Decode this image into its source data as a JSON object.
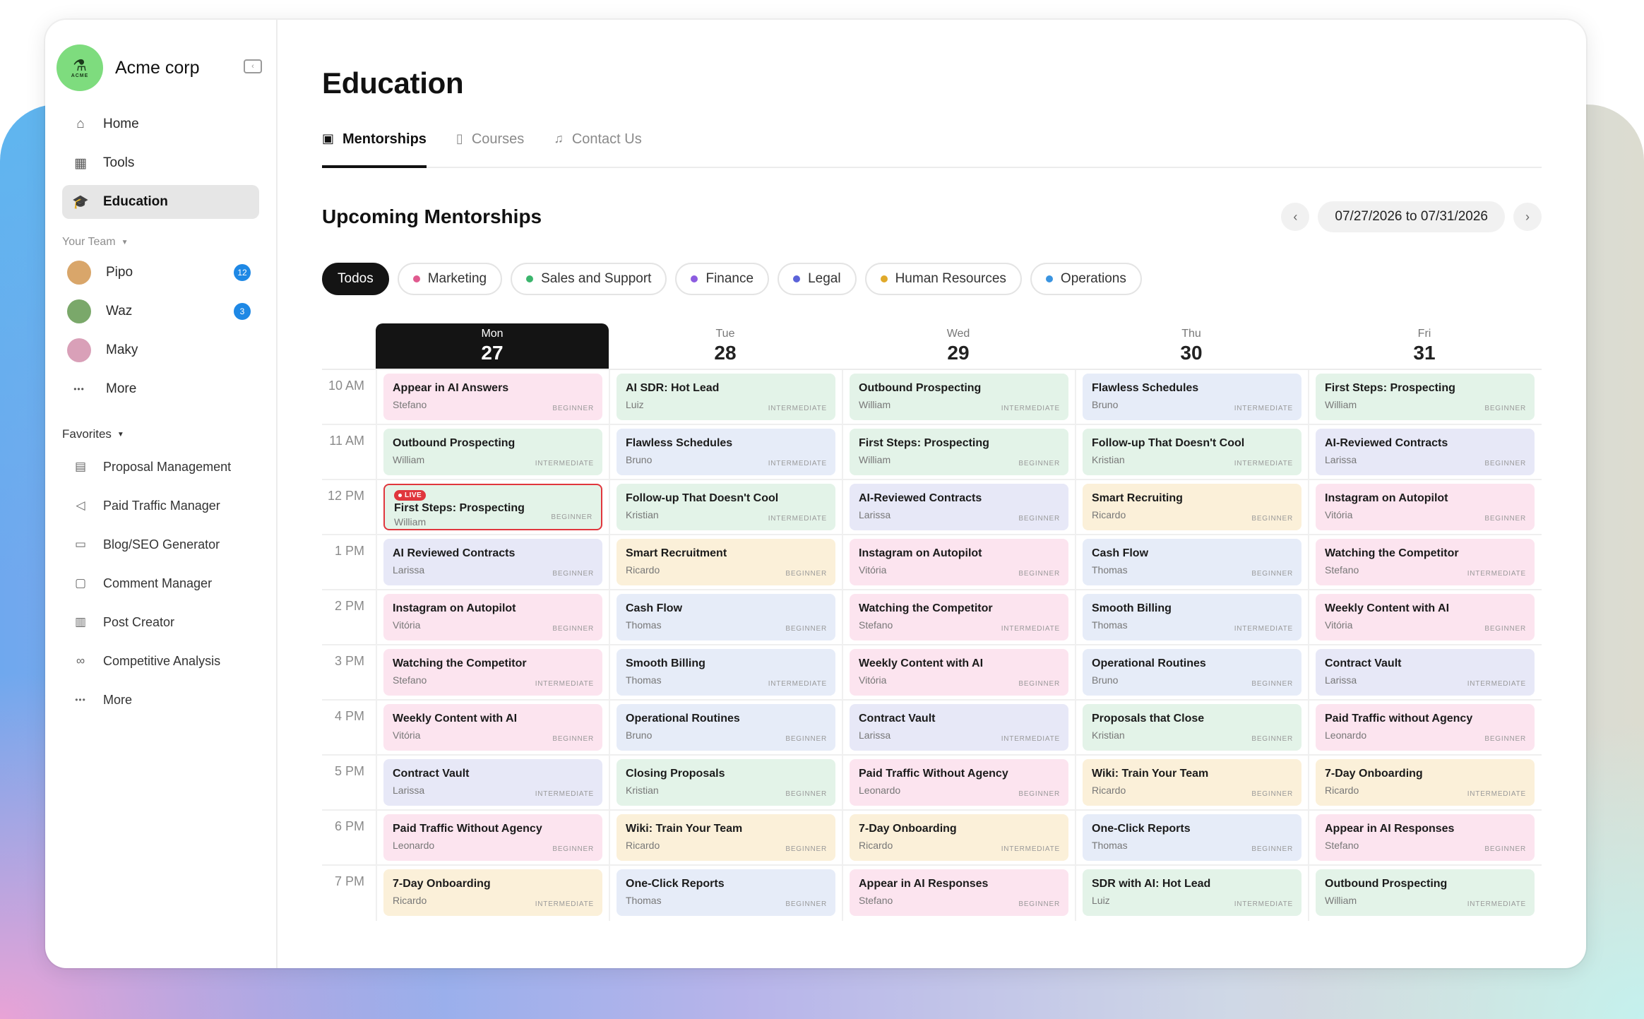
{
  "brand": {
    "name": "Acme corp",
    "logo_text": "ACME"
  },
  "nav": [
    {
      "label": "Home",
      "icon": "home-icon",
      "glyph": "⌂"
    },
    {
      "label": "Tools",
      "icon": "grid-icon",
      "glyph": "▦"
    },
    {
      "label": "Education",
      "icon": "graduation-cap-icon",
      "glyph": "🎓",
      "active": true
    }
  ],
  "team": {
    "label": "Your Team",
    "members": [
      {
        "name": "Pipo",
        "badge": "12",
        "color": "#d9a66a"
      },
      {
        "name": "Waz",
        "badge": "3",
        "color": "#7aa86a"
      },
      {
        "name": "Maky",
        "badge": "",
        "color": "#d9a0b8"
      }
    ],
    "more": "More"
  },
  "favorites": {
    "label": "Favorites",
    "items": [
      {
        "label": "Proposal Management",
        "icon": "document-icon",
        "glyph": "▤"
      },
      {
        "label": "Paid Traffic Manager",
        "icon": "megaphone-icon",
        "glyph": "◁"
      },
      {
        "label": "Blog/SEO Generator",
        "icon": "blog-icon",
        "glyph": "▭"
      },
      {
        "label": "Comment Manager",
        "icon": "comment-icon",
        "glyph": "▢"
      },
      {
        "label": "Post Creator",
        "icon": "layout-icon",
        "glyph": "▥"
      },
      {
        "label": "Competitive Analysis",
        "icon": "binoculars-icon",
        "glyph": "∞"
      }
    ],
    "more": "More"
  },
  "page": {
    "title": "Education",
    "tabs": [
      {
        "label": "Mentorships",
        "icon": "calendar-icon",
        "glyph": "▣",
        "active": true
      },
      {
        "label": "Courses",
        "icon": "book-icon",
        "glyph": "▯",
        "active": false
      },
      {
        "label": "Contact Us",
        "icon": "headset-icon",
        "glyph": "♫",
        "active": false
      }
    ]
  },
  "section": {
    "title": "Upcoming Mentorships",
    "date_range": "07/27/2026 to 07/31/2026",
    "prev": "‹",
    "next": "›"
  },
  "filters": [
    {
      "label": "Todos",
      "active": true,
      "color": ""
    },
    {
      "label": "Marketing",
      "color": "#e05a8f"
    },
    {
      "label": "Sales and Support",
      "color": "#3bb56d"
    },
    {
      "label": "Finance",
      "color": "#8c5ce0"
    },
    {
      "label": "Legal",
      "color": "#5b63d9"
    },
    {
      "label": "Human Resources",
      "color": "#e0a92a"
    },
    {
      "label": "Operations",
      "color": "#3a94e0"
    }
  ],
  "calendar": {
    "days": [
      {
        "name": "Mon",
        "num": "27",
        "today": true
      },
      {
        "name": "Tue",
        "num": "28"
      },
      {
        "name": "Wed",
        "num": "29"
      },
      {
        "name": "Thu",
        "num": "30"
      },
      {
        "name": "Fri",
        "num": "31"
      }
    ],
    "live_label": "LIVE",
    "rows": [
      {
        "time": "10 AM",
        "cells": [
          {
            "title": "Appear in AI Answers",
            "who": "Stefano",
            "level": "BEGINNER",
            "color": "pink"
          },
          {
            "title": "AI SDR: Hot Lead",
            "who": "Luiz",
            "level": "INTERMEDIATE",
            "color": "green"
          },
          {
            "title": "Outbound Prospecting",
            "who": "William",
            "level": "INTERMEDIATE",
            "color": "green"
          },
          {
            "title": "Flawless Schedules",
            "who": "Bruno",
            "level": "INTERMEDIATE",
            "color": "blue"
          },
          {
            "title": "First Steps: Prospecting",
            "who": "William",
            "level": "BEGINNER",
            "color": "green"
          }
        ]
      },
      {
        "time": "11 AM",
        "cells": [
          {
            "title": "Outbound Prospecting",
            "who": "William",
            "level": "INTERMEDIATE",
            "color": "green"
          },
          {
            "title": "Flawless Schedules",
            "who": "Bruno",
            "level": "INTERMEDIATE",
            "color": "blue"
          },
          {
            "title": "First Steps: Prospecting",
            "who": "William",
            "level": "BEGINNER",
            "color": "green"
          },
          {
            "title": "Follow-up That Doesn't Cool",
            "who": "Kristian",
            "level": "INTERMEDIATE",
            "color": "green"
          },
          {
            "title": "AI-Reviewed Contracts",
            "who": "Larissa",
            "level": "BEGINNER",
            "color": "lav"
          }
        ]
      },
      {
        "time": "12 PM",
        "cells": [
          {
            "title": "First Steps: Prospecting",
            "who": "William",
            "level": "BEGINNER",
            "color": "live",
            "live": true
          },
          {
            "title": "Follow-up That Doesn't Cool",
            "who": "Kristian",
            "level": "INTERMEDIATE",
            "color": "green"
          },
          {
            "title": "AI-Reviewed Contracts",
            "who": "Larissa",
            "level": "BEGINNER",
            "color": "lav"
          },
          {
            "title": "Smart Recruiting",
            "who": "Ricardo",
            "level": "BEGINNER",
            "color": "yellow"
          },
          {
            "title": "Instagram on Autopilot",
            "who": "Vitória",
            "level": "BEGINNER",
            "color": "pink"
          }
        ]
      },
      {
        "time": "1 PM",
        "cells": [
          {
            "title": "AI Reviewed Contracts",
            "who": "Larissa",
            "level": "BEGINNER",
            "color": "lav"
          },
          {
            "title": "Smart Recruitment",
            "who": "Ricardo",
            "level": "BEGINNER",
            "color": "yellow"
          },
          {
            "title": "Instagram on Autopilot",
            "who": "Vitória",
            "level": "BEGINNER",
            "color": "pink"
          },
          {
            "title": "Cash Flow",
            "who": "Thomas",
            "level": "BEGINNER",
            "color": "blue"
          },
          {
            "title": "Watching the Competitor",
            "who": "Stefano",
            "level": "INTERMEDIATE",
            "color": "pink"
          }
        ]
      },
      {
        "time": "2 PM",
        "cells": [
          {
            "title": "Instagram on Autopilot",
            "who": "Vitória",
            "level": "BEGINNER",
            "color": "pink"
          },
          {
            "title": "Cash Flow",
            "who": "Thomas",
            "level": "BEGINNER",
            "color": "blue"
          },
          {
            "title": "Watching the Competitor",
            "who": "Stefano",
            "level": "INTERMEDIATE",
            "color": "pink"
          },
          {
            "title": "Smooth Billing",
            "who": "Thomas",
            "level": "INTERMEDIATE",
            "color": "blue"
          },
          {
            "title": "Weekly Content with AI",
            "who": "Vitória",
            "level": "BEGINNER",
            "color": "pink"
          }
        ]
      },
      {
        "time": "3 PM",
        "cells": [
          {
            "title": "Watching the Competitor",
            "who": "Stefano",
            "level": "INTERMEDIATE",
            "color": "pink"
          },
          {
            "title": "Smooth Billing",
            "who": "Thomas",
            "level": "INTERMEDIATE",
            "color": "blue"
          },
          {
            "title": "Weekly Content with AI",
            "who": "Vitória",
            "level": "BEGINNER",
            "color": "pink"
          },
          {
            "title": "Operational Routines",
            "who": "Bruno",
            "level": "BEGINNER",
            "color": "blue"
          },
          {
            "title": "Contract Vault",
            "who": "Larissa",
            "level": "INTERMEDIATE",
            "color": "lav"
          }
        ]
      },
      {
        "time": "4 PM",
        "cells": [
          {
            "title": "Weekly Content with AI",
            "who": "Vitória",
            "level": "BEGINNER",
            "color": "pink"
          },
          {
            "title": "Operational Routines",
            "who": "Bruno",
            "level": "BEGINNER",
            "color": "blue"
          },
          {
            "title": "Contract Vault",
            "who": "Larissa",
            "level": "INTERMEDIATE",
            "color": "lav"
          },
          {
            "title": "Proposals that Close",
            "who": "Kristian",
            "level": "BEGINNER",
            "color": "green"
          },
          {
            "title": "Paid Traffic without Agency",
            "who": "Leonardo",
            "level": "BEGINNER",
            "color": "pink"
          }
        ]
      },
      {
        "time": "5 PM",
        "cells": [
          {
            "title": "Contract Vault",
            "who": "Larissa",
            "level": "INTERMEDIATE",
            "color": "lav"
          },
          {
            "title": "Closing Proposals",
            "who": "Kristian",
            "level": "BEGINNER",
            "color": "green"
          },
          {
            "title": "Paid Traffic Without Agency",
            "who": "Leonardo",
            "level": "BEGINNER",
            "color": "pink"
          },
          {
            "title": "Wiki: Train Your Team",
            "who": "Ricardo",
            "level": "BEGINNER",
            "color": "yellow"
          },
          {
            "title": "7-Day Onboarding",
            "who": "Ricardo",
            "level": "INTERMEDIATE",
            "color": "yellow"
          }
        ]
      },
      {
        "time": "6 PM",
        "cells": [
          {
            "title": "Paid Traffic Without Agency",
            "who": "Leonardo",
            "level": "BEGINNER",
            "color": "pink"
          },
          {
            "title": "Wiki: Train Your Team",
            "who": "Ricardo",
            "level": "BEGINNER",
            "color": "yellow"
          },
          {
            "title": "7-Day Onboarding",
            "who": "Ricardo",
            "level": "INTERMEDIATE",
            "color": "yellow"
          },
          {
            "title": "One-Click Reports",
            "who": "Thomas",
            "level": "BEGINNER",
            "color": "blue"
          },
          {
            "title": "Appear in AI Responses",
            "who": "Stefano",
            "level": "BEGINNER",
            "color": "pink"
          }
        ]
      },
      {
        "time": "7 PM",
        "cells": [
          {
            "title": "7-Day Onboarding",
            "who": "Ricardo",
            "level": "INTERMEDIATE",
            "color": "yellow"
          },
          {
            "title": "One-Click Reports",
            "who": "Thomas",
            "level": "BEGINNER",
            "color": "blue"
          },
          {
            "title": "Appear in AI Responses",
            "who": "Stefano",
            "level": "BEGINNER",
            "color": "pink"
          },
          {
            "title": "SDR with AI: Hot Lead",
            "who": "Luiz",
            "level": "INTERMEDIATE",
            "color": "green"
          },
          {
            "title": "Outbound Prospecting",
            "who": "William",
            "level": "INTERMEDIATE",
            "color": "green"
          }
        ]
      }
    ]
  }
}
